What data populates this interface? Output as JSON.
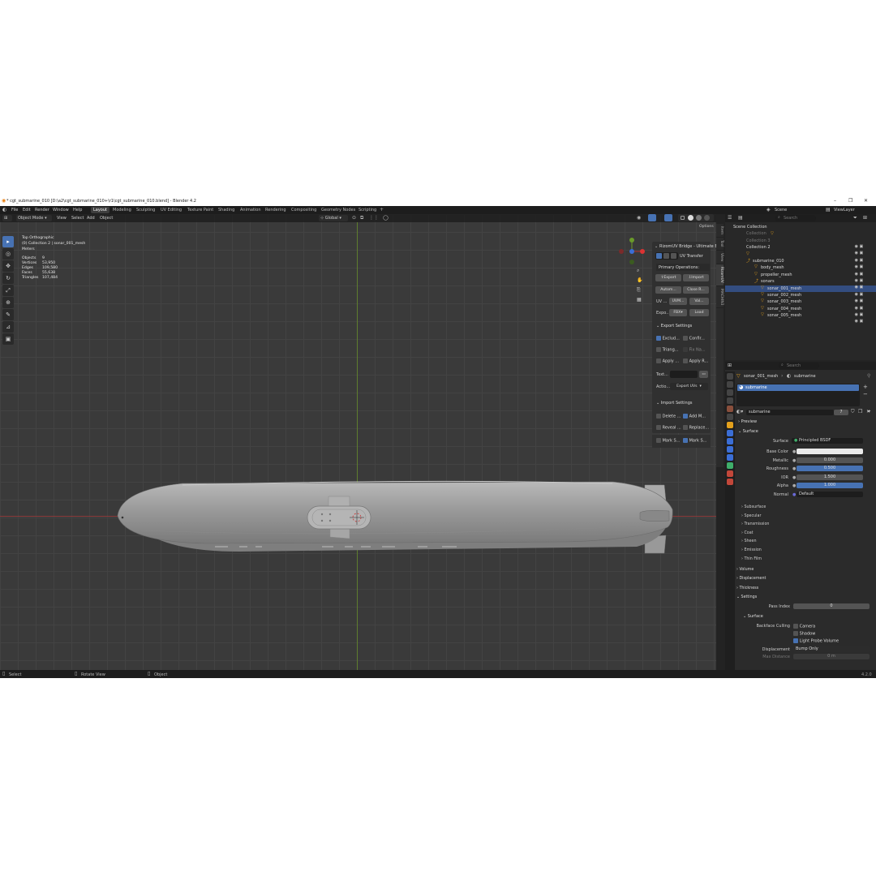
{
  "window": {
    "title": "* cgt_submarine_010 [D:\\a2\\cgt_submarine_010+\\r1\\cgt_submarine_010.blend] - Blender 4.2"
  },
  "menu": [
    "File",
    "Edit",
    "Render",
    "Window",
    "Help"
  ],
  "workspaces": [
    "Layout",
    "Modeling",
    "Sculpting",
    "UV Editing",
    "Texture Paint",
    "Shading",
    "Animation",
    "Rendering",
    "Compositing",
    "Geometry Nodes",
    "Scripting"
  ],
  "header": {
    "mode": "Object Mode",
    "view_menu": [
      "View",
      "Select",
      "Add",
      "Object"
    ],
    "orientation": "Global",
    "scene": "Scene",
    "view_layer": "ViewLayer",
    "search_placeholder": "Search",
    "options": "Options"
  },
  "viewport": {
    "view_name": "Top Orthographic",
    "collection_path": "(0) Collection 2 | sonar_001_mesh",
    "units": "Meters",
    "stats": [
      {
        "label": "Objects",
        "value": "9"
      },
      {
        "label": "Vertices",
        "value": "53,950"
      },
      {
        "label": "Edges",
        "value": "109,580"
      },
      {
        "label": "Faces",
        "value": "55,638"
      },
      {
        "label": "Triangles",
        "value": "107,484"
      }
    ]
  },
  "rizom": {
    "title": "RizomUV Bridge - Ultimate Ed",
    "uv_transfer": "UV Transfer",
    "primary": "Primary Operations:",
    "export": "Export",
    "import": "Import",
    "autom": "Autom...",
    "close": "Close R...",
    "uv_label": "UV ...",
    "uvm": "UVM...",
    "val": "Val...",
    "expo_label": "Expo...",
    "fbx": "FBX",
    "load": "Load",
    "export_settings": "Export Settings",
    "exclud": "Exclud...",
    "confir": "Confir...",
    "triang": "Triang...",
    "fix_na": "Fix Na...",
    "apply1": "Apply ...",
    "apply_r": "Apply R...",
    "text": "Text...",
    "action": "Actio...",
    "export_uvs": "Export UVs",
    "import_settings": "Import Settings",
    "delete": "Delete ...",
    "add_m": "Add M...",
    "reveal": "Reveal ...",
    "replace": "Replace...",
    "mark1": "Mark S...",
    "mark2": "Mark S..."
  },
  "side_tabs": [
    "Item",
    "Tool",
    "View",
    "RizomUV",
    "MACHIN3"
  ],
  "outliner": {
    "rows": [
      {
        "label": "Scene Collection",
        "indent": 0
      },
      {
        "label": "Collection",
        "indent": 1
      },
      {
        "label": "Collection 3",
        "indent": 1
      },
      {
        "label": "Collection 2",
        "indent": 1
      },
      {
        "label": "",
        "indent": 2
      },
      {
        "label": "submarine_010",
        "indent": 2
      },
      {
        "label": "body_mesh",
        "indent": 3
      },
      {
        "label": "propeller_mesh",
        "indent": 3
      },
      {
        "label": "sonars",
        "indent": 3
      },
      {
        "label": "sonar_001_mesh",
        "indent": 4
      },
      {
        "label": "sonar_002_mesh",
        "indent": 4
      },
      {
        "label": "sonar_003_mesh",
        "indent": 4
      },
      {
        "label": "sonar_004_mesh",
        "indent": 4
      },
      {
        "label": "sonar_005_mesh",
        "indent": 4
      }
    ]
  },
  "properties": {
    "object": "sonar_001_mesh",
    "material": "submarine",
    "slot": "submarine",
    "users": "7",
    "sections": {
      "preview": "Preview",
      "surface": "Surface"
    },
    "surface_shader": "Principled BSDF",
    "fields": [
      {
        "label": "Base Color",
        "value": "",
        "kind": "color"
      },
      {
        "label": "Metallic",
        "value": "0.000",
        "kind": "plain"
      },
      {
        "label": "Roughness",
        "value": "0.500",
        "kind": "blue"
      },
      {
        "label": "IOR",
        "value": "1.500",
        "kind": "plain"
      },
      {
        "label": "Alpha",
        "value": "1.000",
        "kind": "blue"
      },
      {
        "label": "Normal",
        "value": "Default",
        "kind": "plain"
      }
    ],
    "subsections": [
      "Subsurface",
      "Specular",
      "Transmission",
      "Coat",
      "Sheen",
      "Emission",
      "Thin Film"
    ],
    "panels": [
      "Volume",
      "Displacement",
      "Thickness",
      "Settings"
    ],
    "pass_index_label": "Pass Index",
    "pass_index": "0",
    "surface2": "Surface",
    "backface": "Backface Culling",
    "camera": "Camera",
    "shadow": "Shadow",
    "light_probe": "Light Probe Volume",
    "displacement_label": "Displacement",
    "displacement": "Bump Only",
    "max_distance_label": "Max Distance",
    "max_distance": "0 m"
  },
  "status": {
    "select": "Select",
    "rotate": "Rotate View",
    "object": "Object",
    "version": "4.2.0"
  }
}
